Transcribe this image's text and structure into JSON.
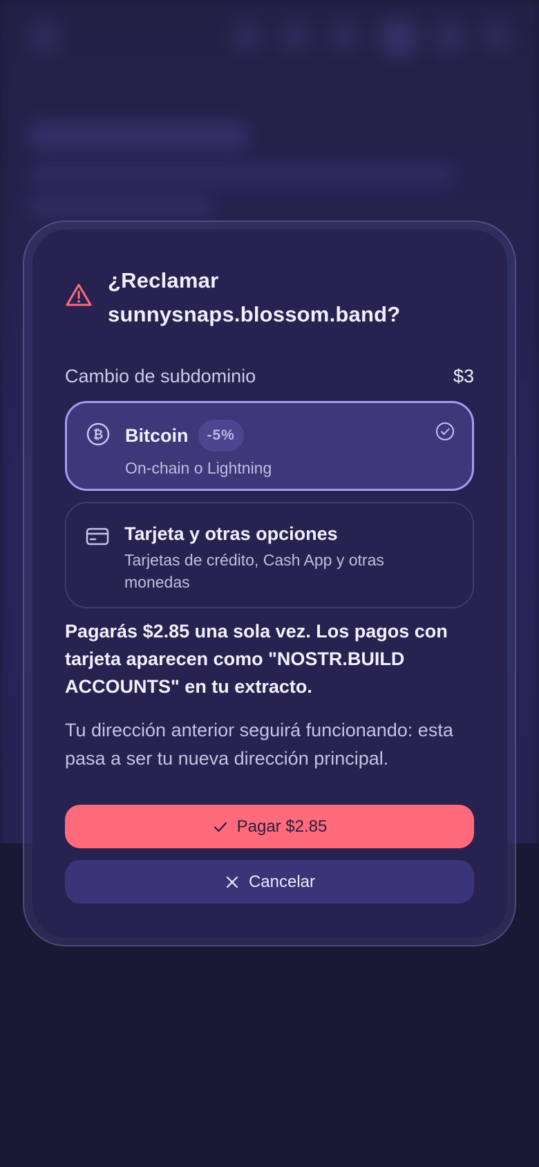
{
  "dialog": {
    "title": "¿Reclamar sunnysnaps.blossom.band?",
    "item_label": "Cambio de subdominio",
    "item_price": "$3",
    "options": [
      {
        "title": "Bitcoin",
        "badge": "-5%",
        "subtitle": "On-chain o Lightning",
        "selected": true,
        "icon": "bitcoin-icon"
      },
      {
        "title": "Tarjeta y otras opciones",
        "subtitle": "Tarjetas de crédito, Cash App y otras monedas",
        "selected": false,
        "icon": "credit-card-icon"
      }
    ],
    "payment_notice": "Pagarás $2.85 una sola vez. Los pagos con tarjeta aparecen como \"NOSTR.BUILD ACCOUNTS\" en tu extracto.",
    "info_text": "Tu dirección anterior seguirá funcionando: esta pasa a ser tu nueva dirección principal.",
    "pay_button": "Pagar $2.85",
    "cancel_button": "Cancelar"
  },
  "colors": {
    "accent": "#ff6b7b",
    "warning_icon": "#ff6b7b",
    "selected_border": "#a49cf0",
    "modal_bg": "#27224f"
  }
}
